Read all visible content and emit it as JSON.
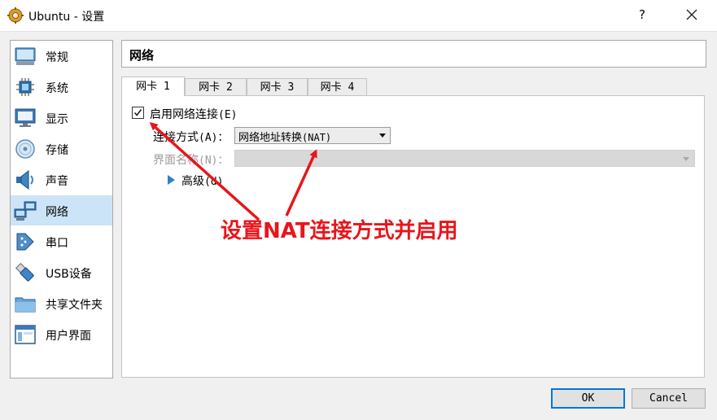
{
  "window": {
    "title": "Ubuntu - 设置",
    "help_label": "?",
    "app_icon": "gear-icon",
    "close_icon": "close-icon"
  },
  "sidebar": {
    "items": [
      {
        "label": "常规",
        "icon": "general-monitor-icon"
      },
      {
        "label": "系统",
        "icon": "system-chip-icon"
      },
      {
        "label": "显示",
        "icon": "display-monitor-icon"
      },
      {
        "label": "存储",
        "icon": "storage-disc-icon"
      },
      {
        "label": "声音",
        "icon": "speaker-icon"
      },
      {
        "label": "网络",
        "icon": "network-icon",
        "selected": true
      },
      {
        "label": "串口",
        "icon": "serial-port-icon"
      },
      {
        "label": "USB设备",
        "icon": "usb-icon"
      },
      {
        "label": "共享文件夹",
        "icon": "shared-folder-icon"
      },
      {
        "label": "用户界面",
        "icon": "user-interface-icon"
      }
    ]
  },
  "panel": {
    "title": "网络"
  },
  "tabs": [
    {
      "label": "网卡 1",
      "active": true
    },
    {
      "label": "网卡 2"
    },
    {
      "label": "网卡 3"
    },
    {
      "label": "网卡 4"
    }
  ],
  "adapter": {
    "enable_label": "启用网络连接",
    "enable_shortcut": "(E)",
    "enabled": true,
    "attached_label": "连接方式",
    "attached_shortcut": "(A)：",
    "attached_value": "网络地址转换",
    "attached_value_suffix": "(NAT)",
    "name_label": "界面名称",
    "name_shortcut": "(N)：",
    "name_value": "",
    "advanced_label": "高级",
    "advanced_shortcut": "(d)"
  },
  "annotation": {
    "text": "设置NAT连接方式并启用",
    "color": "#e8151b"
  },
  "buttons": {
    "ok": "OK",
    "cancel": "Cancel"
  }
}
